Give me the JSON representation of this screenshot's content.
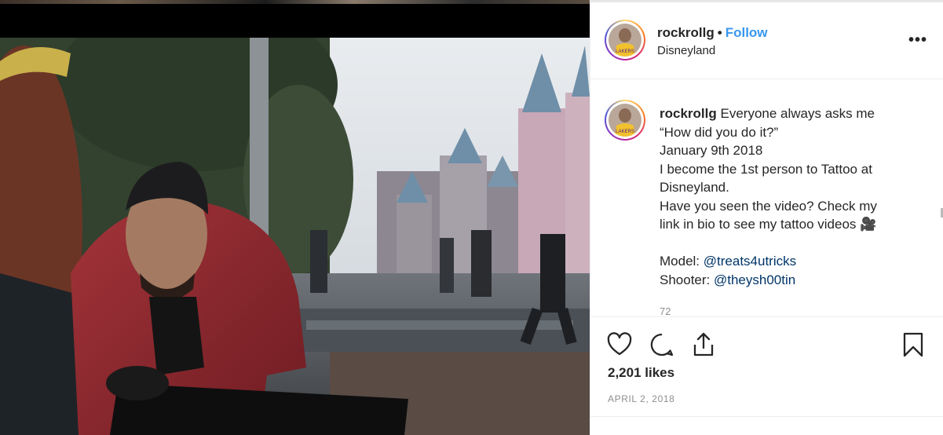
{
  "post": {
    "username": "rockrollg",
    "separator": "•",
    "follow_label": "Follow",
    "location": "Disneyland",
    "more_label": "•••"
  },
  "caption": {
    "username": "rockrollg",
    "lines": [
      "Everyone always asks me",
      "“How did you do it?”",
      "January 9th 2018",
      "I become the 1st person to Tattoo at",
      "Disneyland.",
      "Have you seen the video? Check my",
      "link in bio to see my tattoo videos 🎥"
    ],
    "model_label": "Model:",
    "model_handle": "@treats4utricks",
    "shooter_label": "Shooter:",
    "shooter_handle": "@theysh00tin",
    "partial_text": "72"
  },
  "actions": {
    "like_icon": "heart-icon",
    "comment_icon": "comment-icon",
    "share_icon": "share-icon",
    "save_icon": "bookmark-icon",
    "likes_text": "2,201 likes",
    "date_text": "APRIL 2, 2018"
  },
  "colors": {
    "follow": "#3897f0",
    "mention": "#003569",
    "muted": "#8e8e8e",
    "text": "#262626"
  }
}
